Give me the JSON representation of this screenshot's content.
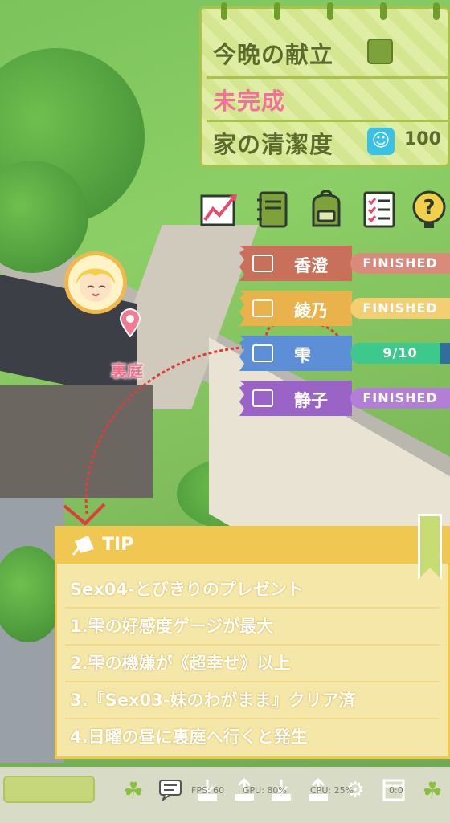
{
  "notepad": {
    "tonight_menu_label": "今晩の献立",
    "status_text": "未完成",
    "cleanliness_label": "家の清潔度",
    "cleanliness_value": "100"
  },
  "toolbar_icons": [
    "chart-icon",
    "notebook-icon",
    "backpack-icon",
    "checklist-icon",
    "question-icon"
  ],
  "characters": [
    {
      "name": "香澄",
      "status": "FINISHED",
      "color": "#c9705a",
      "bar_color": "#d98a7a"
    },
    {
      "name": "綾乃",
      "status": "FINISHED",
      "color": "#e9b24a",
      "bar_color": "#f3cf72"
    },
    {
      "name": "雫",
      "status": "9/10",
      "color": "#5d8fd6",
      "bar_color": "#3ec98c",
      "progress": 0.9
    },
    {
      "name": "静子",
      "status": "FINISHED",
      "color": "#9a64c6",
      "bar_color": "#b27ed8"
    }
  ],
  "map": {
    "location_label": "裏庭"
  },
  "tip": {
    "title": "TIP",
    "lines": [
      "Sex04-とびきりのプレゼント",
      "1.雫の好感度ゲージが最大",
      "2.雫の機嫌が《超幸せ》以上",
      "3.『Sex03-妹のわがまま』クリア済",
      "4.日曜の昼に裏庭へ行くと発生"
    ]
  },
  "bottom_bar": {
    "fps": "FPS: 60",
    "gpu": "GPU: 80%",
    "cpu": "CPU: 25%",
    "extra": "0:0"
  }
}
